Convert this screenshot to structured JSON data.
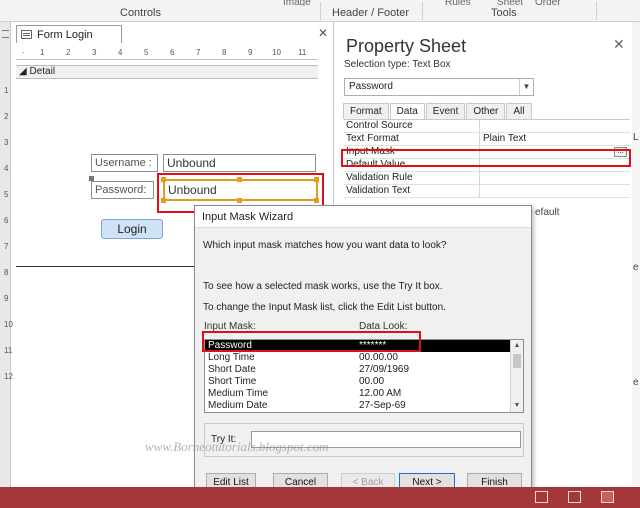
{
  "ribbon": {
    "groups": [
      "Controls",
      "Header / Footer",
      "Tools"
    ],
    "cut_labels": [
      "Image",
      "Rules",
      "Sheet",
      "Order"
    ]
  },
  "form": {
    "tab_title": "Form Login",
    "section_label": "Detail",
    "ruler_h": [
      "1",
      "2",
      "3",
      "4",
      "5",
      "6",
      "7",
      "8",
      "9",
      "10",
      "11"
    ],
    "ruler_v": [
      "1",
      "2",
      "3",
      "4",
      "5",
      "6",
      "7",
      "8",
      "9",
      "10",
      "11",
      "12"
    ],
    "username_label": "Username :",
    "username_value": "Unbound",
    "password_label": "Password:",
    "password_value": "Unbound",
    "login_button": "Login"
  },
  "property_sheet": {
    "title": "Property Sheet",
    "selection_type": "Selection type:  Text Box",
    "selected_control": "Password",
    "tabs": [
      "Format",
      "Data",
      "Event",
      "Other",
      "All"
    ],
    "active_tab": "Data",
    "rows": [
      {
        "key": "Control Source",
        "value": ""
      },
      {
        "key": "Text Format",
        "value": "Plain Text"
      },
      {
        "key": "Input Mask",
        "value": ""
      },
      {
        "key": "Default Value",
        "value": ""
      },
      {
        "key": "Validation Rule",
        "value": ""
      },
      {
        "key": "Validation Text",
        "value": ""
      }
    ],
    "builder_glyph": "...",
    "partial_value": "efault",
    "edge_marks": [
      "L",
      "e",
      "e"
    ]
  },
  "wizard": {
    "title": "Input Mask Wizard",
    "question": "Which input mask matches how you want data to look?",
    "info_try": "To see how a selected mask works, use the Try It box.",
    "info_edit": "To change the Input Mask list, click the Edit List button.",
    "col_mask": "Input Mask:",
    "col_look": "Data Look:",
    "items": [
      {
        "mask": "Password",
        "look": "*******",
        "selected": true
      },
      {
        "mask": "Long Time",
        "look": "00.00.00"
      },
      {
        "mask": "Short Date",
        "look": "27/09/1969"
      },
      {
        "mask": "Short Time",
        "look": "00.00"
      },
      {
        "mask": "Medium Time",
        "look": "12.00 AM"
      },
      {
        "mask": "Medium Date",
        "look": "27-Sep-69"
      }
    ],
    "try_it_label": "Try It:",
    "try_it_value": "",
    "buttons": {
      "edit_list": "Edit List",
      "cancel": "Cancel",
      "back": "< Back",
      "next": "Next >",
      "finish": "Finish"
    },
    "watermark": "www.Borneotutorials.blogspot.com"
  },
  "colors": {
    "highlight_red": "#e0101a",
    "selection_orange": "#e59b1e",
    "statusbar": "#a4373a"
  }
}
